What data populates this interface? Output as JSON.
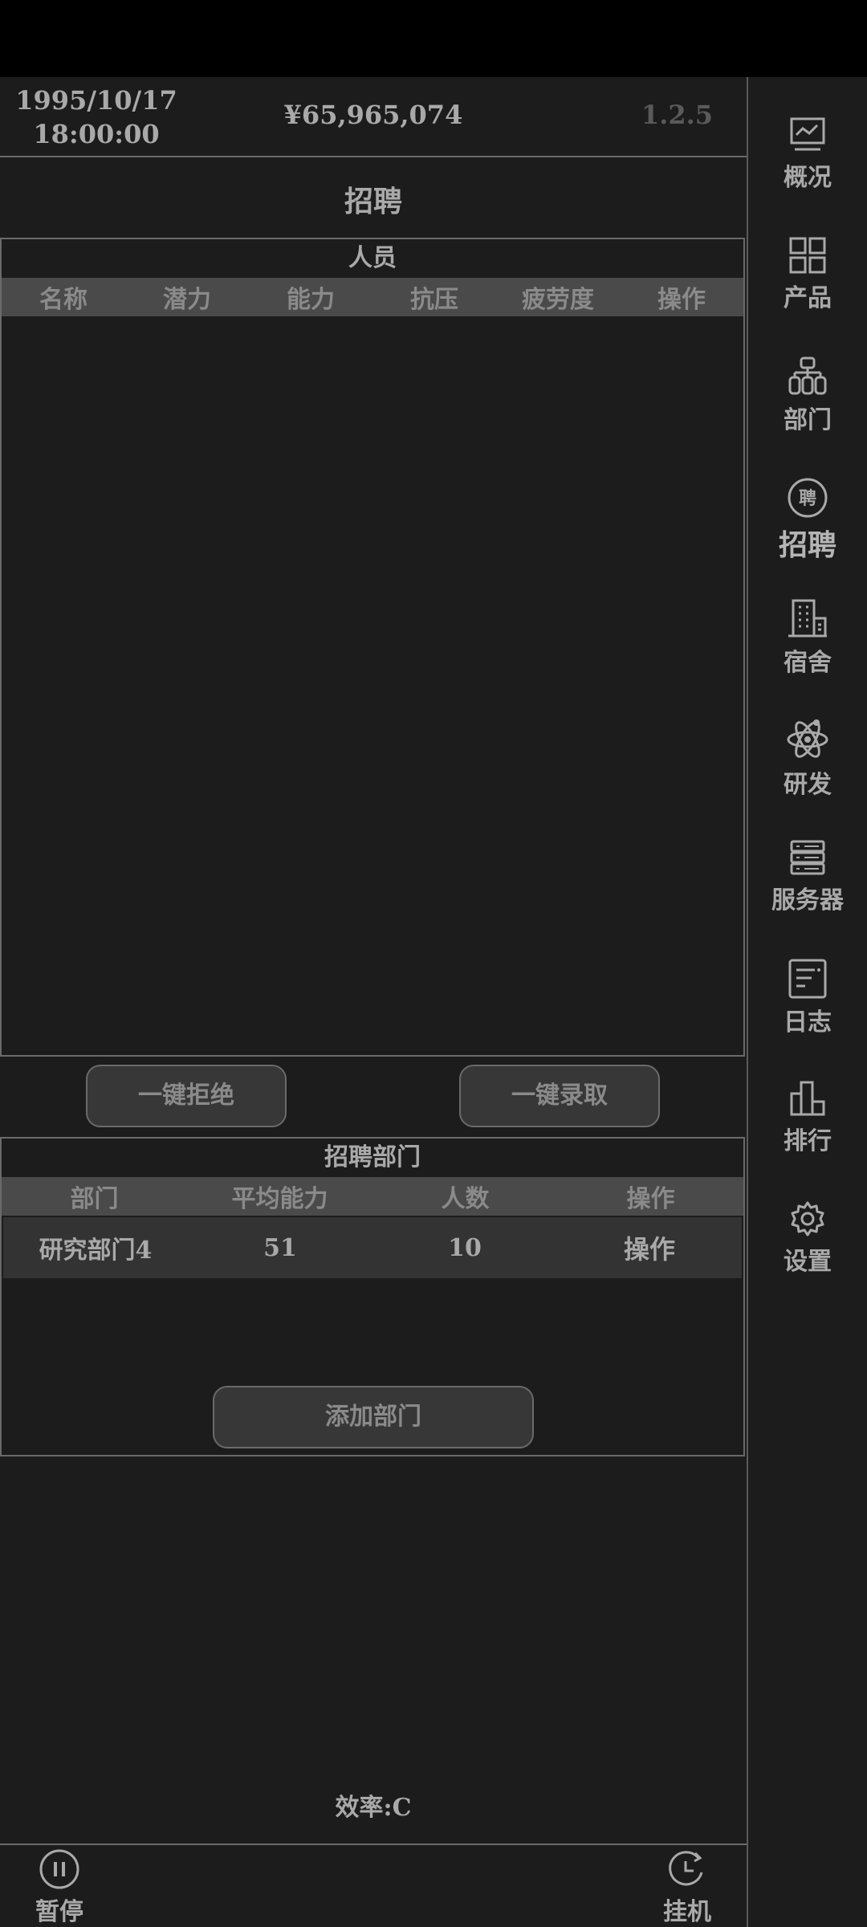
{
  "header": {
    "date": "1995/10/17",
    "time": "18:00:00",
    "money": "¥65,965,074",
    "version": "1.2.5"
  },
  "page_title": "招聘",
  "staff_panel": {
    "title": "人员",
    "columns": [
      "名称",
      "潜力",
      "能力",
      "抗压",
      "疲劳度",
      "操作"
    ]
  },
  "buttons": {
    "reject_all": "一键拒绝",
    "accept_all": "一键录取",
    "add_department": "添加部门"
  },
  "dept_panel": {
    "title": "招聘部门",
    "columns": [
      "部门",
      "平均能力",
      "人数",
      "操作"
    ],
    "rows": [
      {
        "name": "研究部门4",
        "avg_ability": "51",
        "count": "10",
        "action": "操作"
      }
    ]
  },
  "efficiency": "效率:C",
  "bottom": {
    "pause_label": "暂停",
    "afk_label": "挂机"
  },
  "sidebar": {
    "items": [
      {
        "label": "概况",
        "icon": "overview-chart-icon"
      },
      {
        "label": "产品",
        "icon": "product-grid-icon"
      },
      {
        "label": "部门",
        "icon": "department-org-icon"
      },
      {
        "label": "招聘",
        "icon": "recruit-icon",
        "icon_text": "聘",
        "active": true
      },
      {
        "label": "宿舍",
        "icon": "dormitory-building-icon"
      },
      {
        "label": "研发",
        "icon": "research-atom-icon"
      },
      {
        "label": "服务器",
        "icon": "server-icon"
      },
      {
        "label": "日志",
        "icon": "log-document-icon"
      },
      {
        "label": "排行",
        "icon": "ranking-bars-icon"
      },
      {
        "label": "设置",
        "icon": "settings-gear-icon"
      }
    ]
  }
}
